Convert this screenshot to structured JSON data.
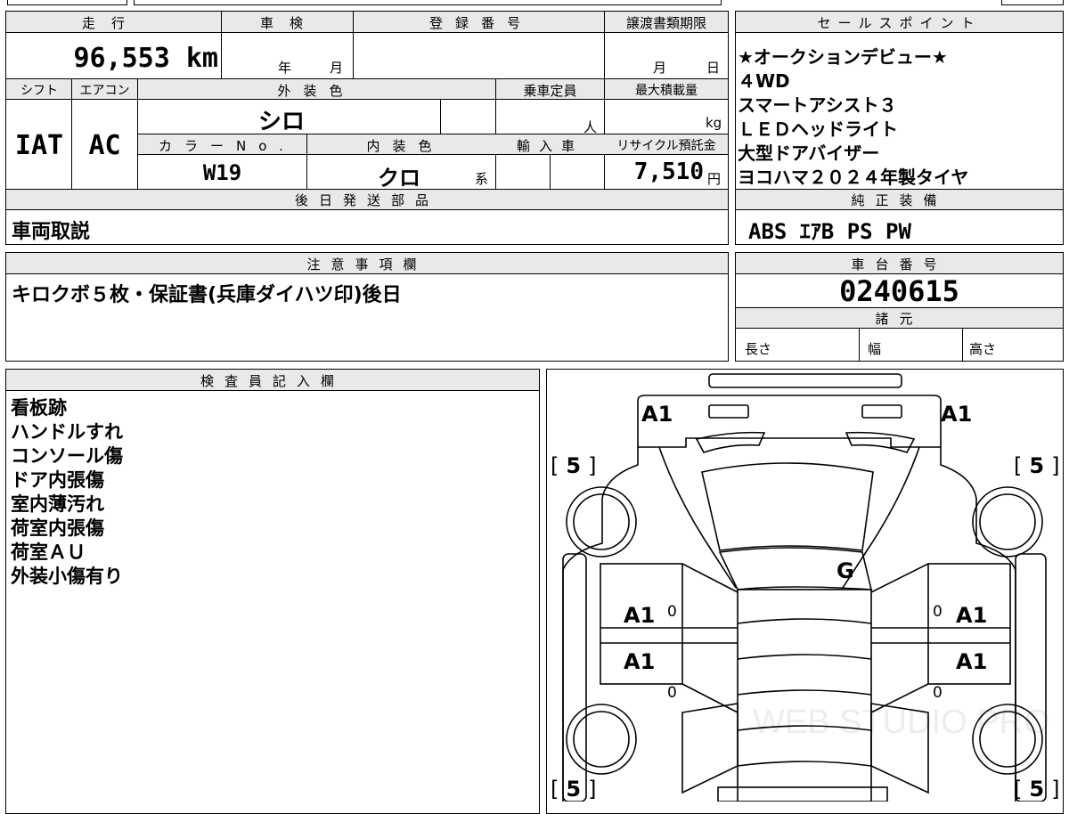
{
  "spec": {
    "mileage_label": "走行",
    "mileage": "96,553 km",
    "inspection_label": "車検",
    "year_unit": "年",
    "month_unit": "月",
    "registration_label": "登録番号",
    "transfer_deadline_label": "譲渡書類期限",
    "day_unit": "日",
    "shift_label": "シフト",
    "shift": "IAT",
    "ac_label": "エアコン",
    "ac": "AC",
    "exterior_color_label": "外装色",
    "exterior_color": "シロ",
    "capacity_label": "乗車定員",
    "person_unit": "人",
    "max_load_label": "最大積載量",
    "kg_unit": "kg",
    "color_no_label": "カラーNo.",
    "color_no": "W19",
    "interior_color_label": "内装色",
    "interior_color": "クロ",
    "series_unit": "系",
    "import_label": "輸入車",
    "recycle_label": "リサイクル預託金",
    "recycle_fee": "7,510",
    "yen_unit": "円",
    "later_parts_label": "後日発送部品",
    "later_parts": "車両取説"
  },
  "sales_points": {
    "label": "セールスポイント",
    "items": [
      "★オークションデビュー★",
      "４WD",
      "スマートアシスト３",
      "ＬＥＤヘッドライト",
      "大型ドアバイザー",
      "ヨコハマ２０２４年製タイヤ"
    ]
  },
  "equipment": {
    "label": "純正装備",
    "value": "ABS ｴｱB PS PW"
  },
  "notes": {
    "label": "注意事項欄",
    "text": "キロクボ５枚・保証書(兵庫ダイハツ印)後日"
  },
  "chassis": {
    "label": "車台番号",
    "number": "0240615",
    "specs_label": "諸元",
    "length_label": "長さ",
    "width_label": "幅",
    "height_label": "高さ"
  },
  "inspector": {
    "label": "検査員記入欄",
    "lines": [
      "看板跡",
      "ハンドルすれ",
      "コンソール傷",
      "ドア内張傷",
      "室内薄汚れ",
      "荷室内張傷",
      "荷室ＡＵ",
      "外装小傷有り"
    ]
  },
  "diagram": {
    "marks": {
      "front_left": "A1",
      "front_right": "A1",
      "windshield": "G",
      "door_fl": "A1",
      "door_fr": "A1",
      "door_rl": "A1",
      "door_rr": "A1",
      "zero": "0",
      "tire": "5",
      "bracket_open": "[",
      "bracket_close": "]"
    },
    "watermark": "WEB STUDIO PRO"
  }
}
